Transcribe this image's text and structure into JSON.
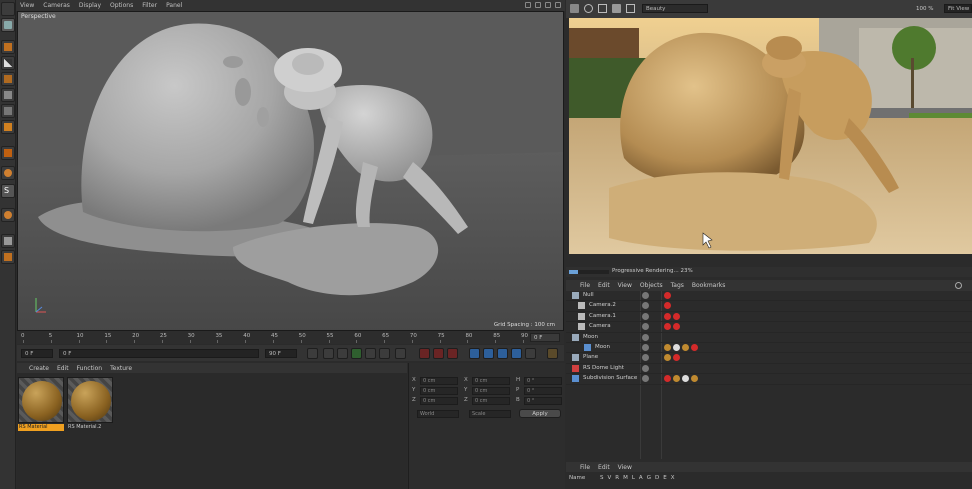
{
  "viewport": {
    "menu": [
      "View",
      "Cameras",
      "Display",
      "Options",
      "Filter",
      "Panel"
    ],
    "label": "Perspective",
    "grid_spacing": "Grid Spacing : 100 cm"
  },
  "timeline": {
    "ticks": [
      "0",
      "5",
      "10",
      "15",
      "20",
      "25",
      "30",
      "35",
      "40",
      "45",
      "50",
      "55",
      "60",
      "65",
      "70",
      "75",
      "80",
      "85",
      "90"
    ],
    "current_frame": "0 F",
    "start_field": "0 F",
    "scrub_field": "0 F",
    "end_field_left": "90 F",
    "end_field_right": "90 F"
  },
  "material_manager": {
    "menu": [
      "Create",
      "Edit",
      "Function",
      "Texture"
    ],
    "materials": [
      {
        "label": "RS Material",
        "selected": true
      },
      {
        "label": "RS Material.2",
        "selected": false
      }
    ]
  },
  "coordinates": {
    "rows": [
      {
        "a": "X",
        "av": "0 cm",
        "b": "X",
        "bv": "0 cm",
        "c": "H",
        "cv": "0 °"
      },
      {
        "a": "Y",
        "av": "0 cm",
        "b": "Y",
        "bv": "0 cm",
        "c": "P",
        "cv": "0 °"
      },
      {
        "a": "Z",
        "av": "0 cm",
        "b": "Z",
        "bv": "0 cm",
        "c": "B",
        "cv": "0 °"
      }
    ],
    "mode_left": "World",
    "mode_mid": "Scale",
    "apply_label": "Apply"
  },
  "render_view": {
    "mode": "Beauty",
    "zoom": "100 %",
    "fit": "Fit View",
    "progress_text": "Progressive Rendering... 23%",
    "progress": 0.23
  },
  "object_manager": {
    "menu": [
      "File",
      "Edit",
      "View",
      "Objects",
      "Tags",
      "Bookmarks"
    ],
    "objects": [
      {
        "name": "Null",
        "indent": 0,
        "type": "null"
      },
      {
        "name": "Camera.2",
        "indent": 1,
        "type": "camera"
      },
      {
        "name": "Camera.1",
        "indent": 1,
        "type": "camera"
      },
      {
        "name": "Camera",
        "indent": 1,
        "type": "camera"
      },
      {
        "name": "Moon",
        "indent": 0,
        "type": "null"
      },
      {
        "name": "Moon",
        "indent": 2,
        "type": "mesh"
      },
      {
        "name": "Plane",
        "indent": 0,
        "type": "null"
      },
      {
        "name": "RS Dome Light",
        "indent": 0,
        "type": "light"
      },
      {
        "name": "Subdivision Surface",
        "indent": 0,
        "type": "subdiv"
      }
    ]
  },
  "attribute_manager": {
    "menu": [
      "File",
      "Edit",
      "View"
    ],
    "name_label": "Name",
    "columns": [
      "S",
      "V",
      "R",
      "M",
      "L",
      "A",
      "G",
      "D",
      "E",
      "X"
    ]
  },
  "colors": {
    "accent_blue": "#4f8fd6",
    "selected_material": "#f0a020",
    "tag_red": "#d42a2a"
  }
}
